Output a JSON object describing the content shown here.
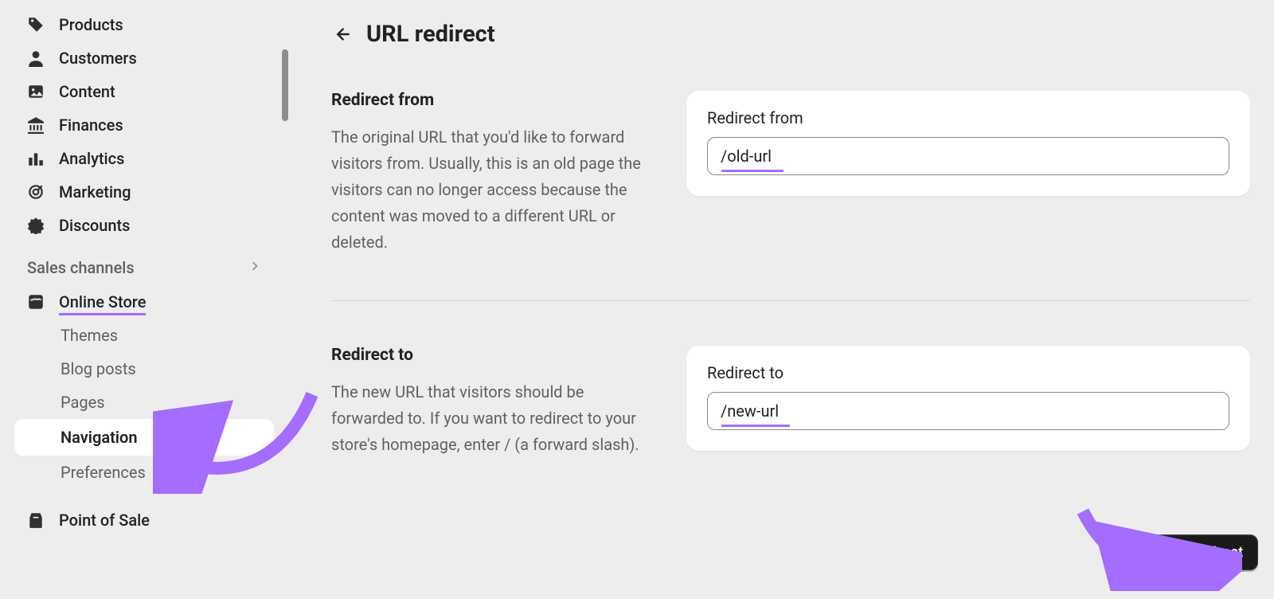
{
  "sidebar": {
    "items": [
      {
        "label": "Products",
        "icon": "tag-icon"
      },
      {
        "label": "Customers",
        "icon": "person-icon"
      },
      {
        "label": "Content",
        "icon": "image-icon"
      },
      {
        "label": "Finances",
        "icon": "bank-icon"
      },
      {
        "label": "Analytics",
        "icon": "bars-icon"
      },
      {
        "label": "Marketing",
        "icon": "target-icon"
      },
      {
        "label": "Discounts",
        "icon": "badge-icon"
      }
    ],
    "section_label": "Sales channels",
    "online_store": {
      "label": "Online Store",
      "icon": "store-icon",
      "children": [
        {
          "label": "Themes"
        },
        {
          "label": "Blog posts"
        },
        {
          "label": "Pages"
        },
        {
          "label": "Navigation",
          "active": true
        },
        {
          "label": "Preferences"
        }
      ]
    },
    "pos": {
      "label": "Point of Sale",
      "icon": "pos-icon"
    }
  },
  "page": {
    "title": "URL redirect",
    "sections": {
      "from": {
        "heading": "Redirect from",
        "description": "The original URL that you'd like to forward visitors from. Usually, this is an old page the visitors can no longer access because the content was moved to a different URL or deleted.",
        "field_label": "Redirect from",
        "value": "/old-url"
      },
      "to": {
        "heading": "Redirect to",
        "description": "The new URL that visitors should be forwarded to. If you want to redirect to your store's homepage, enter / (a forward slash).",
        "field_label": "Redirect to",
        "value": "/new-url"
      }
    },
    "save_label": "Save redirect"
  },
  "annotations": {
    "highlight_color": "#a46cff"
  }
}
